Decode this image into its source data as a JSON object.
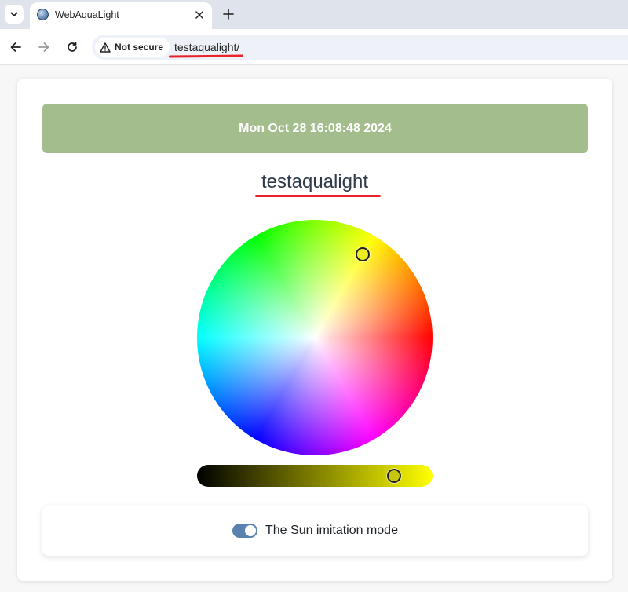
{
  "browser": {
    "tab_title": "WebAquaLight",
    "security_label": "Not secure",
    "url": "testaqualight/",
    "icons": {
      "tab_search": "chevron-down-icon",
      "favicon": "globe-icon",
      "close": "close-icon",
      "new_tab": "plus-icon",
      "back": "arrow-left-icon",
      "forward": "arrow-right-icon",
      "reload": "reload-icon",
      "security": "warning-triangle-icon"
    }
  },
  "page": {
    "datetime": "Mon Oct 28 16:08:48 2024",
    "device_name": "testaqualight",
    "mode_label": "The Sun imitation mode",
    "mode_enabled": true,
    "selected_color": "#ecec22",
    "brightness_fraction": 0.84,
    "colors": {
      "header_bg": "#a4bd8d",
      "toggle_on": "#5a82ae",
      "annotation_underline": "#e8212b"
    }
  }
}
